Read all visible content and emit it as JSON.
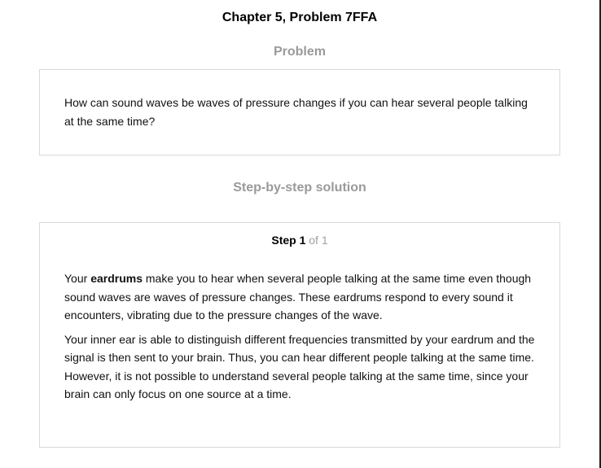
{
  "header": {
    "title": "Chapter 5, Problem 7FFA"
  },
  "problem": {
    "heading": "Problem",
    "text": "How can sound waves be waves of pressure changes if you can hear several people talking at the same time?"
  },
  "solution": {
    "heading": "Step-by-step solution",
    "step": {
      "label": "Step 1",
      "of": " of 1"
    },
    "paragraph1": {
      "prefix": "Your ",
      "bold": "eardrums",
      "rest": " make you to hear when several people talking at the same time even though sound waves are waves of pressure changes. These eardrums respond to every sound it encounters, vibrating due to the pressure changes of the wave."
    },
    "paragraph2": "Your inner ear is able to distinguish different frequencies transmitted by your eardrum and the signal is then sent to your brain. Thus, you can hear different people talking at the same time. However, it is not possible to understand several people talking at the same time, since your brain can only focus on one source at a time."
  }
}
